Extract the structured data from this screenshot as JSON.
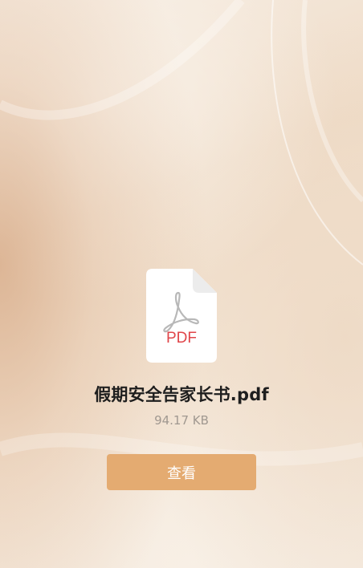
{
  "file": {
    "type_label": "PDF",
    "icon": "pdf-file-icon",
    "name": "假期安全告家长书.pdf",
    "size": "94.17 KB"
  },
  "actions": {
    "view_label": "查看"
  },
  "colors": {
    "button": "#e4ab71",
    "pdf_red": "#e0464a",
    "acrobat_gray": "#b8b8b8"
  }
}
